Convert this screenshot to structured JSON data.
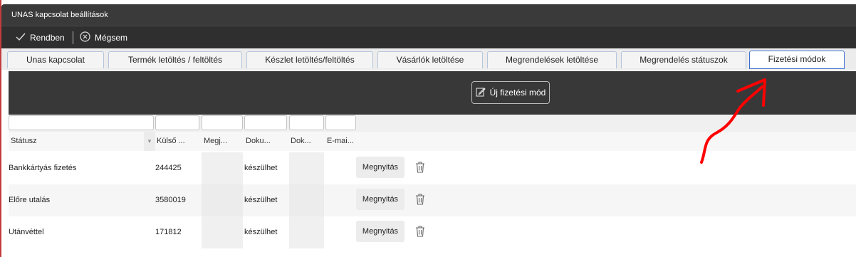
{
  "window": {
    "title": "UNAS kapcsolat beállítások"
  },
  "toolbar": {
    "ok_label": "Rendben",
    "cancel_label": "Mégsem"
  },
  "tabs": [
    {
      "label": "Unas kapcsolat"
    },
    {
      "label": "Termék letöltés / feltöltés"
    },
    {
      "label": "Készlet letöltés/feltöltés"
    },
    {
      "label": "Vásárlók letöltése"
    },
    {
      "label": "Megrendelések letöltése"
    },
    {
      "label": "Megrendelés státuszok"
    },
    {
      "label": "Fizetési módok",
      "active": true
    }
  ],
  "panel": {
    "new_button_label": "Új fizetési mód"
  },
  "table": {
    "columns": [
      "Státusz",
      "Külső ...",
      "Megj...",
      "Doku...",
      "Dok...",
      "E-mai..."
    ],
    "open_label": "Megnyitás",
    "rows": [
      {
        "status": "Bankkártyás fizetés",
        "external": "244425",
        "note": "",
        "doc": "készülhet",
        "dok": "",
        "email": ""
      },
      {
        "status": "Előre utalás",
        "external": "3580019",
        "note": "",
        "doc": "készülhet",
        "dok": "",
        "email": ""
      },
      {
        "status": "Utánvéttel",
        "external": "171812",
        "note": "",
        "doc": "készülhet",
        "dok": "",
        "email": ""
      }
    ]
  },
  "icons": {
    "ok": "check-icon",
    "cancel": "circle-x-icon",
    "new": "edit-icon",
    "delete": "trash-icon"
  },
  "colors": {
    "annotation_arrow": "#ff0000",
    "active_tab_border": "#3d6fcf"
  }
}
